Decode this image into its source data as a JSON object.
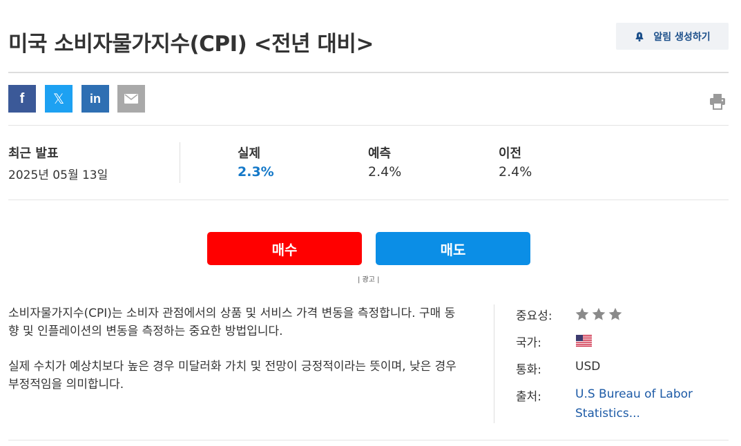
{
  "header": {
    "title": "미국 소비자물가지수(CPI) <전년 대비>",
    "alert_label": "알림 생성하기"
  },
  "share": {
    "facebook_glyph": "f",
    "twitter_glyph": "𝕏",
    "linkedin_glyph": "in"
  },
  "stats": {
    "latest_label": "최근 발표",
    "latest_date": "2025년 05월 13일",
    "actual_label": "실제",
    "actual_value": "2.3%",
    "forecast_label": "예측",
    "forecast_value": "2.4%",
    "previous_label": "이전",
    "previous_value": "2.4%"
  },
  "trade": {
    "buy_label": "매수",
    "sell_label": "매도",
    "ad_label": "| 광고 |"
  },
  "description": {
    "para1": "소비자물가지수(CPI)는 소비자 관점에서의 상품 및 서비스 가격 변동을 측정합니다. 구매 동향 및 인플레이션의 변동을 측정하는 중요한 방법입니다.",
    "para2": "실제 수치가 예상치보다 높은 경우 미달러화 가치 및 전망이 긍정적이라는 뜻이며, 낮은 경우 부정적임을 의미합니다."
  },
  "meta": {
    "importance_label": "중요성:",
    "importance_stars": 3,
    "country_label": "국가:",
    "country_icon": "us-flag-icon",
    "currency_label": "통화:",
    "currency_value": "USD",
    "source_label": "출처:",
    "source_value": "U.S Bureau of Labor Statistics..."
  },
  "colors": {
    "actual": "#1478c8",
    "buy": "#ff0000",
    "sell": "#0b8ee6",
    "link": "#1c5aa6",
    "star": "#8a8a8a"
  }
}
